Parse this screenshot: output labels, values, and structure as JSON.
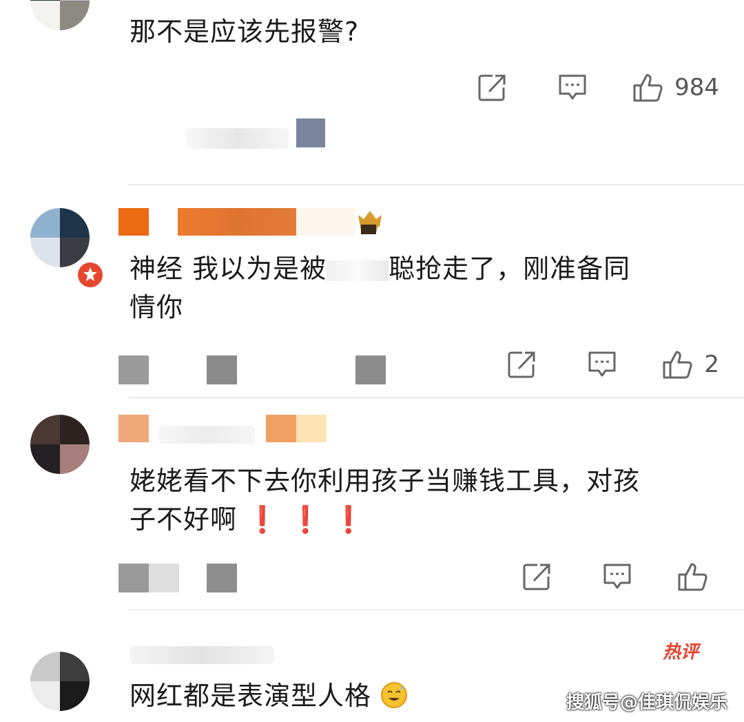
{
  "comments": [
    {
      "text": "那不是应该先报警?",
      "like_count": "984"
    },
    {
      "text_line1": "神经 我以为是被",
      "text_line1_tail": "聪抢走了，刚准备同",
      "text_line2": "情你",
      "like_count": "2"
    },
    {
      "text_line1": "姥姥看不下去你利用孩子当赚钱工具，对孩",
      "text_line2": "子不好啊",
      "marks": "❗ ❗ ❗",
      "like_count": ""
    },
    {
      "text": "网红都是表演型人格",
      "hot_label": "热评"
    }
  ],
  "watermark": "搜狐号@佳琪侃娱乐",
  "icons": {
    "share": "share-icon",
    "comment": "comment-icon",
    "like": "thumbs-up-icon",
    "verified": "verified-badge-icon",
    "emoji": "sweat-smile-emoji-icon"
  },
  "colors": {
    "accent_red": "#e5432e",
    "divider": "#ececec",
    "icon_gray": "#555555"
  }
}
